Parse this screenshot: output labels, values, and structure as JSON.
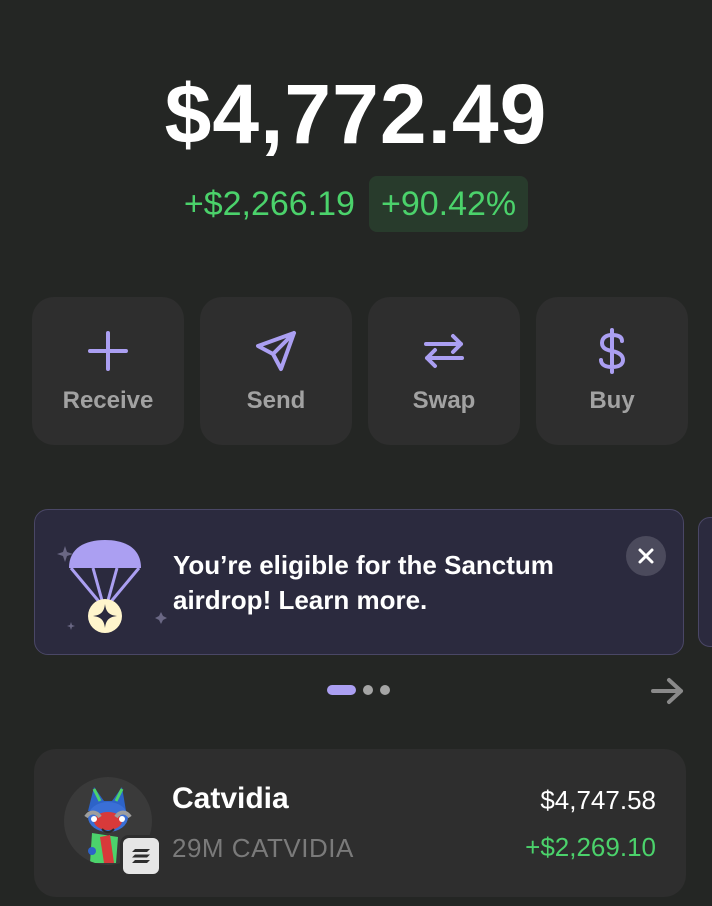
{
  "balance": {
    "total": "$4,772.49",
    "change_amount": "+$2,266.19",
    "change_percent": "+90.42%"
  },
  "actions": [
    {
      "label": "Receive",
      "icon": "plus-icon"
    },
    {
      "label": "Send",
      "icon": "send-icon"
    },
    {
      "label": "Swap",
      "icon": "swap-icon"
    },
    {
      "label": "Buy",
      "icon": "dollar-icon"
    }
  ],
  "banner": {
    "text": "You’re eligible for the Sanctum airdrop! Learn more.",
    "icon": "parachute-airdrop-icon",
    "close_icon": "close-icon"
  },
  "carousel": {
    "page_count": 3,
    "active_index": 0,
    "next_icon": "arrow-right-icon"
  },
  "tokens": [
    {
      "name": "Catvidia",
      "amount": "29M CATVIDIA",
      "value": "$4,747.58",
      "change": "+$2,269.10",
      "chain_icon": "solana-icon"
    }
  ],
  "colors": {
    "background": "#242624",
    "accent": "#ab9ff2",
    "positive": "#4bd26b",
    "card": "#2e2e2e"
  }
}
